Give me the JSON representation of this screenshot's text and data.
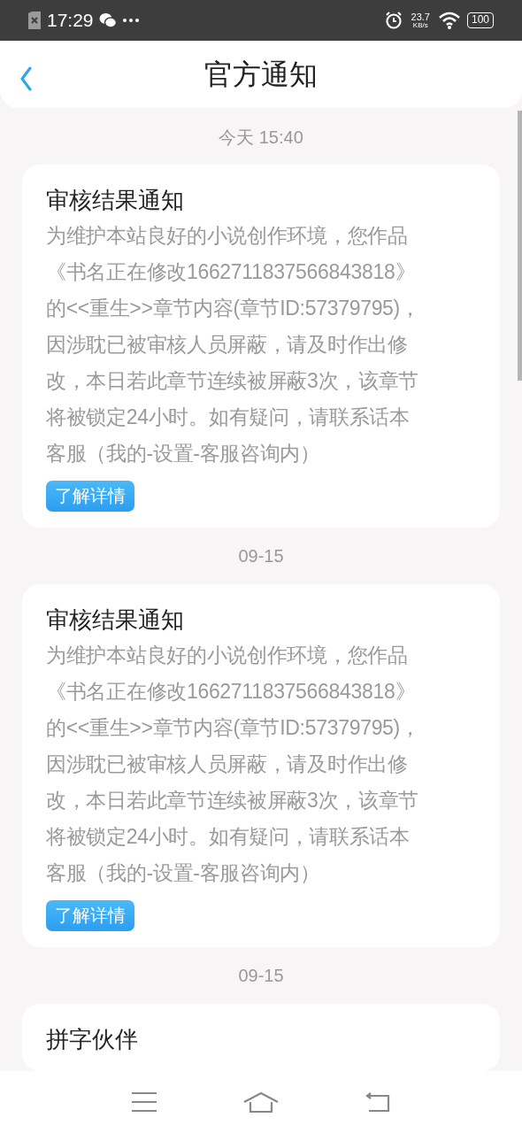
{
  "status_bar": {
    "time": "17:29",
    "speed_value": "23.7",
    "speed_unit": "KB/s",
    "battery": "100"
  },
  "header": {
    "title": "官方通知"
  },
  "messages": [
    {
      "date": "今天 15:40",
      "title": "审核结果通知",
      "body_lines": [
        "为维护本站良好的小说创作环境，您作品",
        "《书名正在修改1662711837566843818》",
        "的<<重生>>章节内容(章节ID:57379795)，",
        "因涉耽已被审核人员屏蔽，请及时作出修",
        "改，本日若此章节连续被屏蔽3次，该章节",
        "将被锁定24小时。如有疑问，请联系话本",
        "客服（我的-设置-客服咨询内）"
      ],
      "button": "了解详情"
    },
    {
      "date": "09-15",
      "title": "审核结果通知",
      "body_lines": [
        "为维护本站良好的小说创作环境，您作品",
        "《书名正在修改1662711837566843818》",
        "的<<重生>>章节内容(章节ID:57379795)，",
        "因涉耽已被审核人员屏蔽，请及时作出修",
        "改，本日若此章节连续被屏蔽3次，该章节",
        "将被锁定24小时。如有疑问，请联系话本",
        "客服（我的-设置-客服咨询内）"
      ],
      "button": "了解详情"
    },
    {
      "date": "09-15",
      "title": "拼字伙伴"
    }
  ]
}
